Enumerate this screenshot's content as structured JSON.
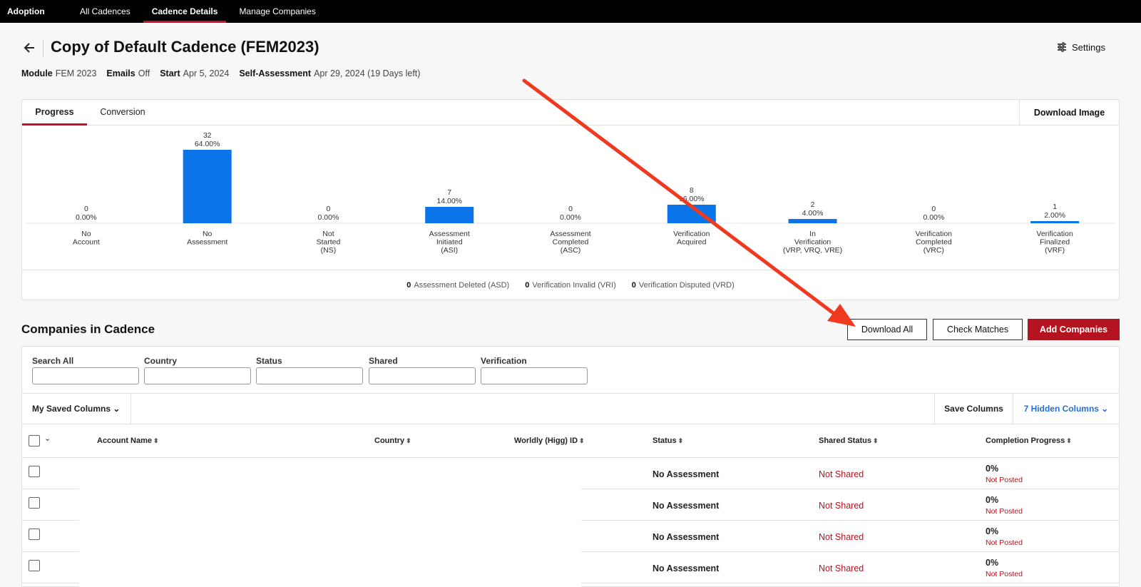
{
  "topnav": {
    "brand": "Adoption",
    "items": [
      "All Cadences",
      "Cadence Details",
      "Manage Companies"
    ],
    "active_index": 1
  },
  "header": {
    "title": "Copy of Default Cadence (FEM2023)",
    "settings_label": "Settings"
  },
  "meta": {
    "module_label": "Module",
    "module_value": "FEM 2023",
    "emails_label": "Emails",
    "emails_value": "Off",
    "start_label": "Start",
    "start_value": "Apr 5, 2024",
    "self_label": "Self-Assessment",
    "self_value": "Apr 29, 2024 (19 Days left)"
  },
  "chart_tabs": {
    "progress": "Progress",
    "conversion": "Conversion",
    "download_image": "Download Image"
  },
  "chart_data": {
    "type": "bar",
    "categories": [
      [
        "No",
        "Account"
      ],
      [
        "No",
        "Assessment"
      ],
      [
        "Not",
        "Started",
        "(NS)"
      ],
      [
        "Assessment",
        "Initiated",
        "(ASI)"
      ],
      [
        "Assessment",
        "Completed",
        "(ASC)"
      ],
      [
        "Verification",
        "Acquired"
      ],
      [
        "In",
        "Verification",
        "(VRP, VRQ, VRE)"
      ],
      [
        "Verification",
        "Completed",
        "(VRC)"
      ],
      [
        "Verification",
        "Finalized",
        "(VRF)"
      ]
    ],
    "values": [
      0,
      32,
      0,
      7,
      0,
      8,
      2,
      0,
      1
    ],
    "percent_labels": [
      "0.00%",
      "64.00%",
      "0.00%",
      "14.00%",
      "0.00%",
      "16.00%",
      "4.00%",
      "0.00%",
      "2.00%"
    ],
    "bar_color": "#0a74e8"
  },
  "chart_footer": [
    {
      "count": "0",
      "label": "Assessment Deleted (ASD)"
    },
    {
      "count": "0",
      "label": "Verification Invalid (VRI)"
    },
    {
      "count": "0",
      "label": "Verification Disputed (VRD)"
    }
  ],
  "companies": {
    "title": "Companies in Cadence",
    "download_all": "Download All",
    "check_matches": "Check Matches",
    "add_companies": "Add Companies"
  },
  "filters": {
    "search": "Search All",
    "country": "Country",
    "status": "Status",
    "shared": "Shared",
    "verification": "Verification"
  },
  "columns_bar": {
    "saved": "My Saved Columns ⌄",
    "save": "Save Columns",
    "hidden": "7 Hidden Columns ⌄"
  },
  "table": {
    "headers": {
      "account": "Account Name",
      "country": "Country",
      "worldly": "Worldly (Higg) ID",
      "status": "Status",
      "shared": "Shared Status",
      "completion": "Completion Progress"
    },
    "sort_glyph": "⬍",
    "rows": [
      {
        "status": "No Assessment",
        "shared": "Not Shared",
        "pct": "0%",
        "posted": "Not Posted"
      },
      {
        "status": "No Assessment",
        "shared": "Not Shared",
        "pct": "0%",
        "posted": "Not Posted"
      },
      {
        "status": "No Assessment",
        "shared": "Not Shared",
        "pct": "0%",
        "posted": "Not Posted"
      },
      {
        "status": "No Assessment",
        "shared": "Not Shared",
        "pct": "0%",
        "posted": "Not Posted"
      }
    ]
  },
  "colors": {
    "brand_red": "#b3141f",
    "accent_blue": "#1f6fd6",
    "annotation_arrow": "#f03a20"
  }
}
